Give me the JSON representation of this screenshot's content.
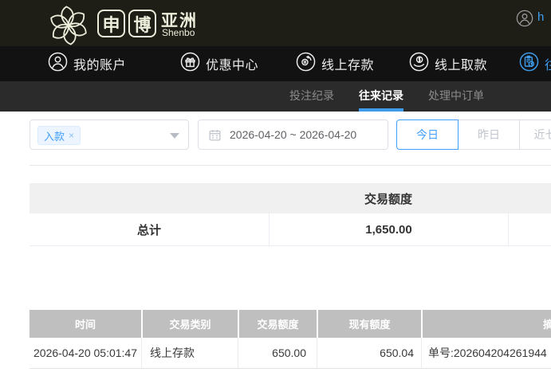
{
  "brand": {
    "box1": "申",
    "box2": "博",
    "region": "亚洲",
    "latin": "Shenbo"
  },
  "user": {
    "name": "h"
  },
  "main_nav": {
    "items": [
      {
        "label": "我的账户",
        "icon": "user-icon"
      },
      {
        "label": "优惠中心",
        "icon": "gift-icon"
      },
      {
        "label": "线上存款",
        "icon": "deposit-icon"
      },
      {
        "label": "线上取款",
        "icon": "withdraw-icon"
      },
      {
        "label": "往来记录",
        "icon": "records-icon"
      }
    ]
  },
  "sub_nav": {
    "tabs": [
      {
        "label": "投注纪录",
        "active": false
      },
      {
        "label": "往来记录",
        "active": true
      },
      {
        "label": "处理中订单",
        "active": false
      }
    ]
  },
  "filters": {
    "type_tag": "入款",
    "tag_close": "×",
    "date_range": "2026-04-20 ~ 2026-04-20",
    "quick_buttons": [
      {
        "label": "今日",
        "active": true
      },
      {
        "label": "昨日",
        "active": false
      },
      {
        "label": "近七日",
        "active": false
      }
    ]
  },
  "summary_table": {
    "amount_header": "交易额度",
    "total_label": "总计",
    "total_value": "1,650.00"
  },
  "records_table": {
    "headers": [
      "时间",
      "交易类别",
      "交易额度",
      "现有额度",
      "摘要"
    ],
    "rows": [
      [
        "2026-04-20 05:01:47",
        "线上存款",
        "650.00",
        "650.04",
        "单号:202604204261944"
      ]
    ]
  },
  "colors": {
    "topbar_bg": "#1e1e17",
    "nav_bg": "#121212",
    "subnav_bg": "#2b2b2b",
    "brand_cream": "#eceedb",
    "accent_blue": "#409eff",
    "nav_active_blue": "#3d9be9",
    "summary_header_bg": "#f0f0f0",
    "records_header_bg": "#bfbfbf"
  }
}
